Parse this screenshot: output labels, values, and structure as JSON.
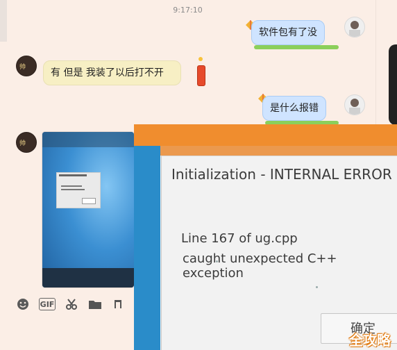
{
  "chat": {
    "timestamp": "9:17:10",
    "messages": [
      {
        "from": "me",
        "text": "软件包有了没"
      },
      {
        "from": "peer",
        "text": "有  但是  我装了以后打不开"
      },
      {
        "from": "me",
        "text": "是什么报错"
      },
      {
        "from": "peer",
        "type": "image"
      }
    ]
  },
  "toolbar": {
    "emoji_icon": "smiley-icon",
    "gif_label": "GIF",
    "scissors_icon": "scissors-icon",
    "folder_icon": "folder-icon",
    "music_icon": "music-icon"
  },
  "error_photo": {
    "title": "Initialization - INTERNAL ERROR",
    "line1": "Line 167 of ug.cpp",
    "line2": "caught unexpected C++ exception",
    "button_label": "确定"
  },
  "watermark": "全攻略",
  "colors": {
    "background": "#fbeee6",
    "my_bubble": "#cfe4ff",
    "peer_bubble": "#f7efc4",
    "orange_bar": "#f08d2e"
  }
}
